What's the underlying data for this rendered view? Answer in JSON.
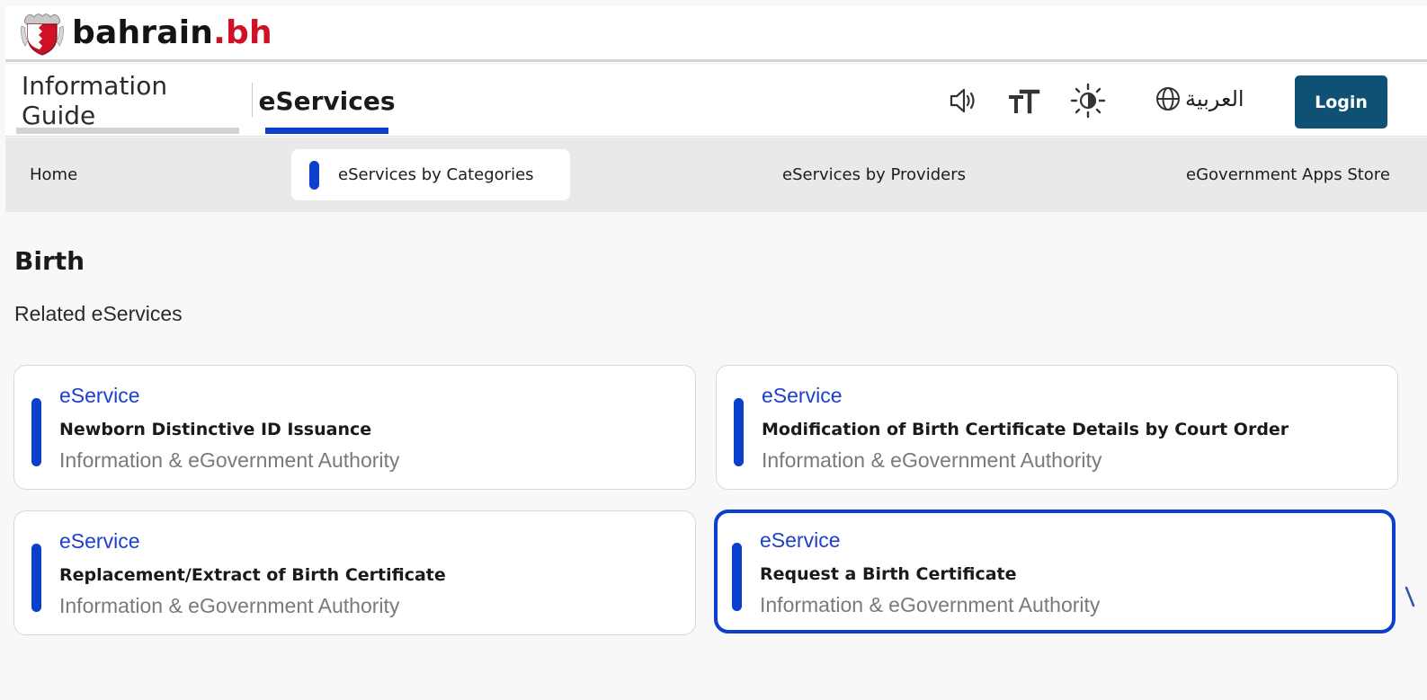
{
  "header": {
    "brand_name": "bahrain",
    "brand_tld": ".bh",
    "logo_icon": "bahrain-emblem-icon",
    "brand_color": "#ce1126"
  },
  "main_nav": {
    "tabs": [
      {
        "label": "Information Guide",
        "active": false
      },
      {
        "label": "eServices",
        "active": true
      }
    ],
    "tools": {
      "audio_icon": "speaker-icon",
      "text_size_icon": "text-size-icon",
      "contrast_icon": "brightness-icon",
      "language_label": "العربية",
      "language_icon": "globe-icon"
    },
    "login_label": "Login",
    "login_color": "#0e5175"
  },
  "sub_nav": {
    "items": [
      {
        "label": "Home",
        "active": false
      },
      {
        "label": "eServices by Categories",
        "active": true
      },
      {
        "label": "eServices by Providers",
        "active": false
      },
      {
        "label": "eGovernment Apps Store",
        "active": false
      }
    ]
  },
  "content": {
    "title": "Birth",
    "subtitle": "Related eServices",
    "accent_color": "#0b3fce",
    "cards": [
      {
        "kind": "eService",
        "name": "Newborn Distinctive ID Issuance",
        "provider": "Information & eGovernment Authority"
      },
      {
        "kind": "eService",
        "name": "Modification of Birth Certificate Details by Court Order",
        "provider": "Information & eGovernment Authority"
      },
      {
        "kind": "eService",
        "name": "Replacement/Extract of Birth Certificate",
        "provider": "Information & eGovernment Authority"
      },
      {
        "kind": "eService",
        "name": "Request a Birth Certificate",
        "provider": "Information & eGovernment Authority",
        "focused": true
      }
    ]
  }
}
